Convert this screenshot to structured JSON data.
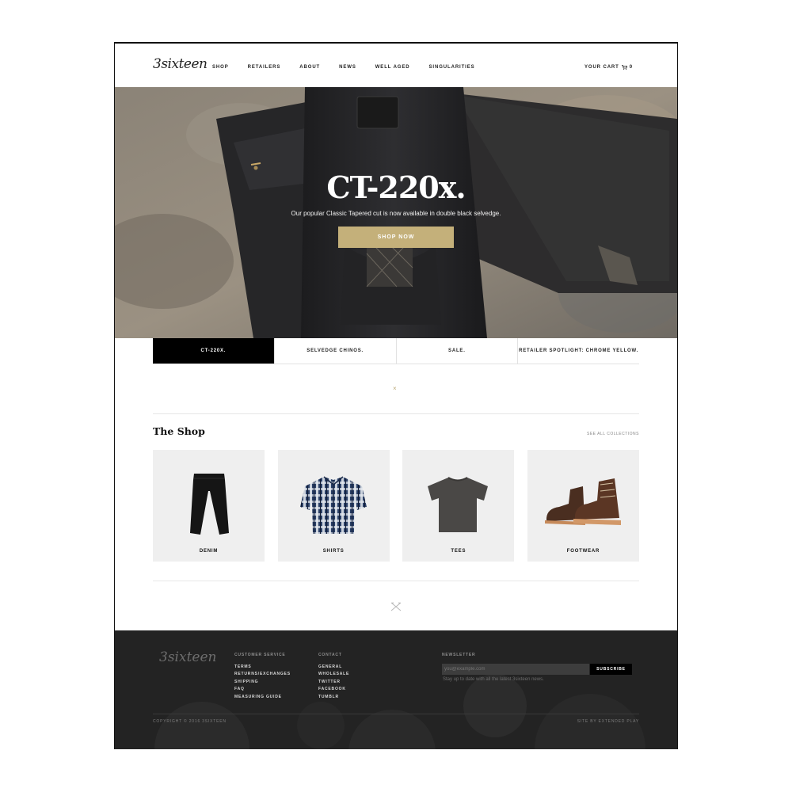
{
  "header": {
    "logo": "3sixteen",
    "nav": [
      "SHOP",
      "RETAILERS",
      "ABOUT",
      "NEWS",
      "WELL AGED",
      "SINGULARITIES"
    ],
    "cart_label": "YOUR CART",
    "cart_count": "0"
  },
  "hero": {
    "title": "CT-220x.",
    "subtitle": "Our popular Classic Tapered cut is now available in double black selvedge.",
    "button": "SHOP NOW"
  },
  "tabs": [
    {
      "label": "CT-220X.",
      "active": true
    },
    {
      "label": "SELVEDGE CHINOS.",
      "active": false
    },
    {
      "label": "SALE.",
      "active": false
    },
    {
      "label": "RETAILER SPOTLIGHT: CHROME YELLOW.",
      "active": false
    }
  ],
  "shop": {
    "title": "The Shop",
    "see_all": "SEE ALL COLLECTIONS",
    "categories": [
      {
        "label": "DENIM",
        "icon": "denim-pants-icon"
      },
      {
        "label": "SHIRTS",
        "icon": "plaid-shirt-icon"
      },
      {
        "label": "TEES",
        "icon": "tee-shirt-icon"
      },
      {
        "label": "FOOTWEAR",
        "icon": "boot-icon"
      }
    ]
  },
  "footer": {
    "logo": "3sixteen",
    "customer_service": {
      "heading": "CUSTOMER SERVICE",
      "links": [
        "TERMS",
        "RETURNS/EXCHANGES",
        "SHIPPING",
        "FAQ",
        "MEASURING GUIDE"
      ]
    },
    "contact": {
      "heading": "CONTACT",
      "links": [
        "GENERAL",
        "WHOLESALE",
        "TWITTER",
        "FACEBOOK",
        "TUMBLR"
      ]
    },
    "newsletter": {
      "heading": "NEWSLETTER",
      "placeholder": "you@example.com",
      "button": "SUBSCRIBE",
      "note": "Stay up to date with all the latest 3sixteen news."
    },
    "copyright": "COPYRIGHT © 2016 3SIXTEEN",
    "credit": "SITE BY EXTENDED PLAY"
  },
  "colors": {
    "accent_gold": "#c4b07a",
    "footer_bg": "#232323"
  }
}
